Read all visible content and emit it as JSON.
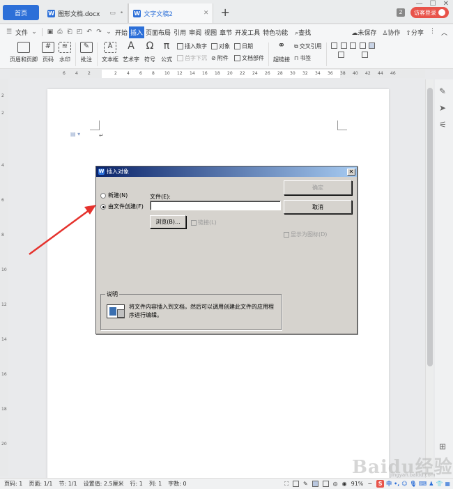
{
  "tabs": {
    "home": "首页",
    "doc1": "图形文档.docx",
    "doc2": "文字文稿2",
    "count": "2",
    "login": "访客登录"
  },
  "menu": {
    "file": "文件",
    "items": [
      "开始",
      "插入",
      "页面布局",
      "引用",
      "审阅",
      "视图",
      "章节",
      "开发工具",
      "特色功能"
    ],
    "search": "查找",
    "unsaved": "未保存",
    "collab": "协作",
    "share": "分享"
  },
  "ribbon": {
    "header_footer": "页眉和页脚",
    "page_number": "页码",
    "watermark": "水印",
    "comment": "批注",
    "textbox": "文本框",
    "wordart": "艺术字",
    "symbol": "符号",
    "formula": "公式",
    "insert_number": "插入数字",
    "object": "对象",
    "date": "日期",
    "drop_cap": "首字下沉",
    "attachment": "附件",
    "doc_parts": "文档部件",
    "hyperlink": "超链接",
    "cross_ref": "交叉引用",
    "bookmark": "书签"
  },
  "ruler": {
    "numbers": [
      "6",
      "4",
      "2",
      "2",
      "4",
      "6",
      "8",
      "10",
      "12",
      "14",
      "16",
      "18",
      "20",
      "22",
      "24",
      "26",
      "28",
      "30",
      "32",
      "34",
      "36",
      "38",
      "40",
      "42",
      "44",
      "46"
    ]
  },
  "dialog": {
    "title": "插入对象",
    "radio_new": "新建(N)",
    "radio_from_file": "由文件创建(F)",
    "file_label": "文件(E):",
    "file_value": "",
    "ok": "确定",
    "cancel": "取消",
    "browse": "浏览(B)...",
    "link": "链接(L)",
    "display_as_icon": "显示为图标(D)",
    "desc_legend": "说明",
    "desc_text": "将文件内容插入到文档，然后可以调用创建此文件的应用程序进行编辑。"
  },
  "status": {
    "page_num": "页码: 1",
    "pages": "页面: 1/1",
    "section": "节: 1/1",
    "setting": "设置值: 2.5厘米",
    "row": "行: 1",
    "col": "列: 1",
    "words": "字数: 0",
    "zoom": "91%"
  },
  "watermark": {
    "brand": "Baidu经验",
    "url": "jingyan.baidu.com"
  }
}
